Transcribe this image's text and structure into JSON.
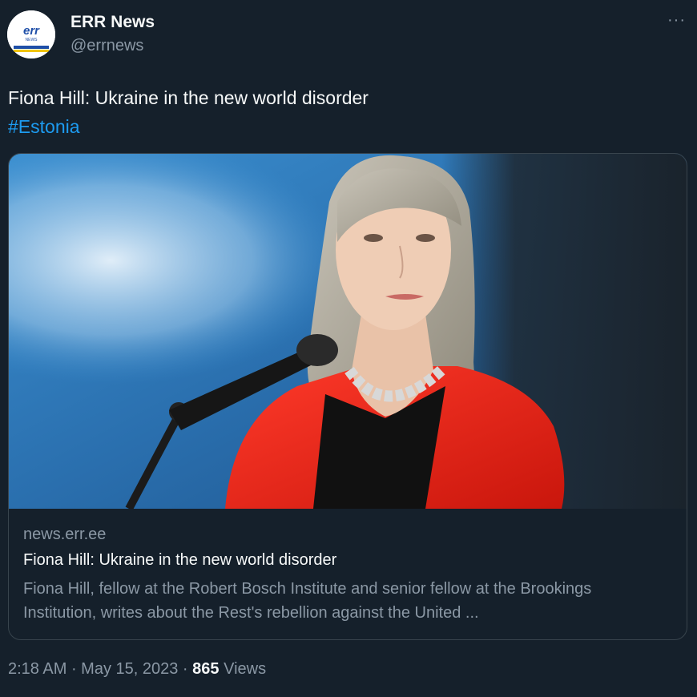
{
  "author": {
    "name": "ERR News",
    "handle": "@errnews",
    "avatar_text": "err",
    "avatar_subtext": "NEWS"
  },
  "more_label": "···",
  "tweet": {
    "text": "Fiona Hill: Ukraine in the new world disorder",
    "hashtag": "#Estonia"
  },
  "card": {
    "domain": "news.err.ee",
    "title": "Fiona Hill: Ukraine in the new world disorder",
    "description": "Fiona Hill, fellow at the Robert Bosch Institute and senior fellow at the Brookings Institution, writes about the Rest's rebellion against the United ...",
    "image_alt": "Photo of a woman in a red jacket speaking at a microphone"
  },
  "meta": {
    "time": "2:18 AM",
    "date": "May 15, 2023",
    "separator": " · ",
    "views_count": "865",
    "views_label": "Views"
  },
  "colors": {
    "background": "#15202b",
    "accent": "#1d9bf0",
    "secondary_text": "#8b98a5"
  }
}
